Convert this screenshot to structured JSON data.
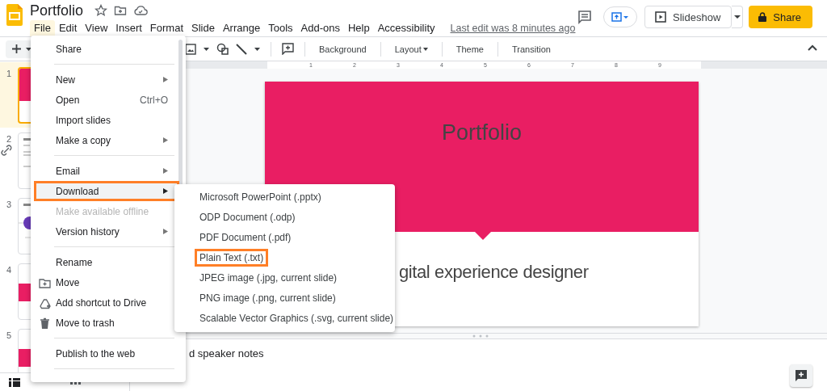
{
  "document": {
    "title": "Portfolio"
  },
  "menubar": [
    {
      "label": "File",
      "selected": true
    },
    {
      "label": "Edit",
      "selected": false
    },
    {
      "label": "View",
      "selected": false
    },
    {
      "label": "Insert",
      "selected": false
    },
    {
      "label": "Format",
      "selected": false
    },
    {
      "label": "Slide",
      "selected": false
    },
    {
      "label": "Arrange",
      "selected": false
    },
    {
      "label": "Tools",
      "selected": false
    },
    {
      "label": "Add-ons",
      "selected": false
    },
    {
      "label": "Help",
      "selected": false
    },
    {
      "label": "Accessibility",
      "selected": false
    }
  ],
  "last_edit": "Last edit was 8 minutes ago",
  "slideshow_button": "Slideshow",
  "share_button": "Share",
  "toolbar": [
    {
      "label": "Background",
      "dropdown": false
    },
    {
      "label": "Layout",
      "dropdown": true
    },
    {
      "label": "Theme",
      "dropdown": false
    },
    {
      "label": "Transition",
      "dropdown": false
    }
  ],
  "ruler": [
    "1",
    "2",
    "3",
    "4",
    "5",
    "6",
    "7",
    "8",
    "9"
  ],
  "slides": [
    {
      "number": "1",
      "kind": "title",
      "selected": true
    },
    {
      "number": "2",
      "kind": "text",
      "selected": false
    },
    {
      "number": "3",
      "kind": "circle",
      "selected": false
    },
    {
      "number": "4",
      "kind": "block",
      "selected": false
    },
    {
      "number": "5",
      "kind": "block",
      "selected": false
    }
  ],
  "slide": {
    "title": "Portfolio",
    "subtitle": "gital experience designer"
  },
  "speaker_notes": "d speaker notes",
  "file_menu": [
    {
      "kind": "item",
      "label": "Share",
      "submenu": false,
      "selected": false,
      "disabled": false,
      "highlighted": false
    },
    {
      "kind": "separator"
    },
    {
      "kind": "item",
      "label": "New",
      "submenu": true,
      "selected": false,
      "disabled": false,
      "highlighted": false
    },
    {
      "kind": "item",
      "label": "Open",
      "shortcut": "Ctrl+O",
      "submenu": false,
      "selected": false,
      "disabled": false,
      "highlighted": false
    },
    {
      "kind": "item",
      "label": "Import slides",
      "submenu": false,
      "selected": false,
      "disabled": false,
      "highlighted": false
    },
    {
      "kind": "item",
      "label": "Make a copy",
      "submenu": true,
      "selected": false,
      "disabled": false,
      "highlighted": false
    },
    {
      "kind": "separator"
    },
    {
      "kind": "item",
      "label": "Email",
      "submenu": true,
      "selected": false,
      "disabled": false,
      "highlighted": false
    },
    {
      "kind": "item",
      "label": "Download",
      "submenu": true,
      "selected": true,
      "disabled": false,
      "highlighted": true
    },
    {
      "kind": "item",
      "label": "Make available offline",
      "submenu": false,
      "selected": false,
      "disabled": true,
      "highlighted": false
    },
    {
      "kind": "item",
      "label": "Version history",
      "submenu": true,
      "selected": false,
      "disabled": false,
      "highlighted": false
    },
    {
      "kind": "separator"
    },
    {
      "kind": "item",
      "label": "Rename",
      "submenu": false,
      "selected": false,
      "disabled": false,
      "highlighted": false
    },
    {
      "kind": "folder-item",
      "label": "Move",
      "submenu": false,
      "selected": false,
      "disabled": false,
      "highlighted": false
    },
    {
      "kind": "drive-item",
      "label": "Add shortcut to Drive",
      "submenu": false,
      "selected": false,
      "disabled": false,
      "highlighted": false
    },
    {
      "kind": "trash-item",
      "label": "Move to trash",
      "submenu": false,
      "selected": false,
      "disabled": false,
      "highlighted": false
    },
    {
      "kind": "separator"
    },
    {
      "kind": "item",
      "label": "Publish to the web",
      "submenu": false,
      "selected": false,
      "disabled": false,
      "highlighted": false
    },
    {
      "kind": "separator"
    }
  ],
  "download_menu": [
    {
      "label": "Microsoft PowerPoint (.pptx)",
      "highlighted": false
    },
    {
      "label": "ODP Document (.odp)",
      "highlighted": false
    },
    {
      "label": "PDF Document (.pdf)",
      "highlighted": false
    },
    {
      "label": "Plain Text (.txt)",
      "highlighted": true
    },
    {
      "label": "JPEG image (.jpg, current slide)",
      "highlighted": false
    },
    {
      "label": "PNG image (.png, current slide)",
      "highlighted": false
    },
    {
      "label": "Scalable Vector Graphics (.svg, current slide)",
      "highlighted": false
    }
  ]
}
